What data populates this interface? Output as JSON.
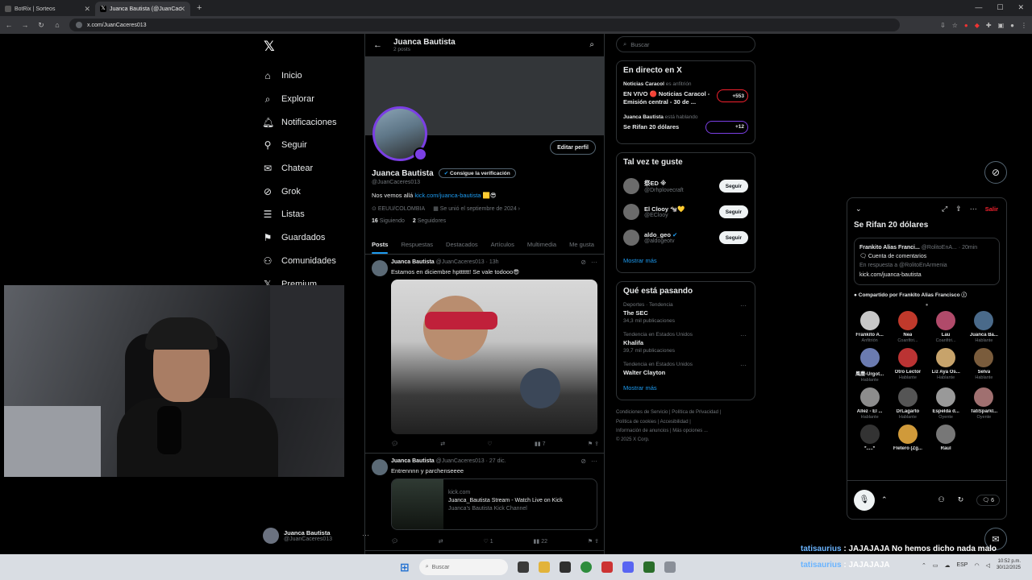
{
  "browser": {
    "tabs": [
      {
        "title": "BotRix | Sorteos",
        "active": false
      },
      {
        "title": "Juanca Bautista (@JuanCac",
        "active": true
      }
    ],
    "url": "x.com/JuanCaceres013"
  },
  "nav": {
    "items": [
      "Inicio",
      "Explorar",
      "Notificaciones",
      "Seguir",
      "Chatear",
      "Grok",
      "Listas",
      "Guardados",
      "Comunidades",
      "Premium"
    ],
    "account_name": "Juanca Bautista",
    "account_handle": "@JuanCaceres013"
  },
  "profile": {
    "header_name": "Juanca Bautista",
    "header_posts": "2 posts",
    "edit_label": "Editar perfil",
    "name": "Juanca Bautista",
    "verify_label": "Consigue la verificación",
    "handle": "@JuanCaceres013",
    "bio_prefix": "Nos vemos allá ",
    "bio_link": "kick.com/juanca-bautista",
    "location": "EEUU/COLOMBIA",
    "joined": "Se unió el septiembre de 2024",
    "following_count": "16",
    "following_label": "Siguiendo",
    "followers_count": "2",
    "followers_label": "Seguidores",
    "tabs": [
      "Posts",
      "Respuestas",
      "Destacados",
      "Artículos",
      "Multimedia",
      "Me gusta"
    ]
  },
  "posts": [
    {
      "name": "Juanca Bautista",
      "handle": "@JuanCaceres013",
      "time": "· 13h",
      "text": "Estamos en diciembre hptttttt! Se vale todooo😎",
      "views": "7",
      "likes": ""
    },
    {
      "name": "Juanca Bautista",
      "handle": "@JuanCaceres013",
      "time": "· 27 dic.",
      "text": "Entrennnn y parchenseeee",
      "card_domain": "kick.com",
      "card_title": "Juanca_Bautista Stream - Watch Live on Kick",
      "card_desc": "Juanca's Bautista Kick Channel",
      "likes": "1",
      "views": "22"
    }
  ],
  "right": {
    "search_placeholder": "Buscar",
    "live_title": "En directo en X",
    "live": [
      {
        "host": "Noticias Caracol",
        "role": "es anfitrión",
        "title": "EN VIVO 🔴 Noticias Caracol - Emisión central - 30 de ...",
        "count": "+553"
      },
      {
        "host": "Juanca Bautista",
        "role": "está hablando",
        "title": "Se Rifan 20 dólares",
        "count": "+12"
      }
    ],
    "suggest_title": "Tal vez te guste",
    "suggestions": [
      {
        "name": "祭ED ※",
        "handle": "@Drhplovecraft",
        "button": "Seguir"
      },
      {
        "name": "El Clooy 🐄💛",
        "handle": "@EClooy",
        "button": "Seguir"
      },
      {
        "name": "aldo_geo",
        "handle": "@aldogeotv",
        "button": "Seguir"
      }
    ],
    "show_more": "Mostrar más",
    "trends_title": "Qué está pasando",
    "trends": [
      {
        "context": "Deportes · Tendencia",
        "name": "The SEC",
        "posts": "34,3 mil publicaciones"
      },
      {
        "context": "Tendencia en Estados Unidos",
        "name": "Khalifa",
        "posts": "39,7 mil publicaciones"
      },
      {
        "context": "Tendencia en Estados Unidos",
        "name": "Walter Clayton",
        "posts": ""
      }
    ],
    "show_more2": "Mostrar más",
    "footer": [
      "Condiciones de Servicio | Política de Privacidad |",
      "Política de cookies | Accesibilidad |",
      "Información de anuncios | Más opciones ...",
      "© 2025 X Corp."
    ]
  },
  "space": {
    "leave": "Salir",
    "title": "Se Rifan 20 dólares",
    "pinned_author": "Frankito Alias Franci...",
    "pinned_handle": "@RolitoEnA...",
    "pinned_time": "· 20min",
    "pinned_line2": "Cuenta de comentarios",
    "pinned_line3": "En respuesta a @RolitoEnArmenia",
    "pinned_link": "kick.com/juanca-bautista",
    "shared_by": "Compartido por Frankito Alias Francisco",
    "participants": [
      {
        "name": "Frankito A...",
        "role": "Anfitrión"
      },
      {
        "name": "Nea",
        "role": "Coanfitri..."
      },
      {
        "name": "Lau",
        "role": "Coanfitri..."
      },
      {
        "name": "Juanca Ba...",
        "role": "Hablante"
      },
      {
        "name": "風塵-Urgot...",
        "role": "Hablante"
      },
      {
        "name": "Otro Lector",
        "role": "Hablante"
      },
      {
        "name": "Liz Aya Os...",
        "role": "Hablante"
      },
      {
        "name": "Selva",
        "role": "Hablante"
      },
      {
        "name": "Allez - El ...",
        "role": "Hablante"
      },
      {
        "name": "DrLagarto",
        "role": "Hablante"
      },
      {
        "name": "Espelda d...",
        "role": "Oyente"
      },
      {
        "name": "TatiSparkl...",
        "role": "Oyente"
      },
      {
        "name": "*.....*",
        "role": ""
      },
      {
        "name": "Fletero (Zg...",
        "role": ""
      },
      {
        "name": "Raul",
        "role": ""
      }
    ],
    "comments_count": "6"
  },
  "chat": [
    {
      "user": "tatisaurius",
      "msg": " : JAJAJAJA No hemos dicho nada malo"
    },
    {
      "user": "tatisaurius",
      "msg": " : JAJAJAJA"
    }
  ],
  "taskbar": {
    "search": "Buscar",
    "lang": "ESP",
    "time": "10:52 p.m.",
    "date": "30/12/2025"
  }
}
